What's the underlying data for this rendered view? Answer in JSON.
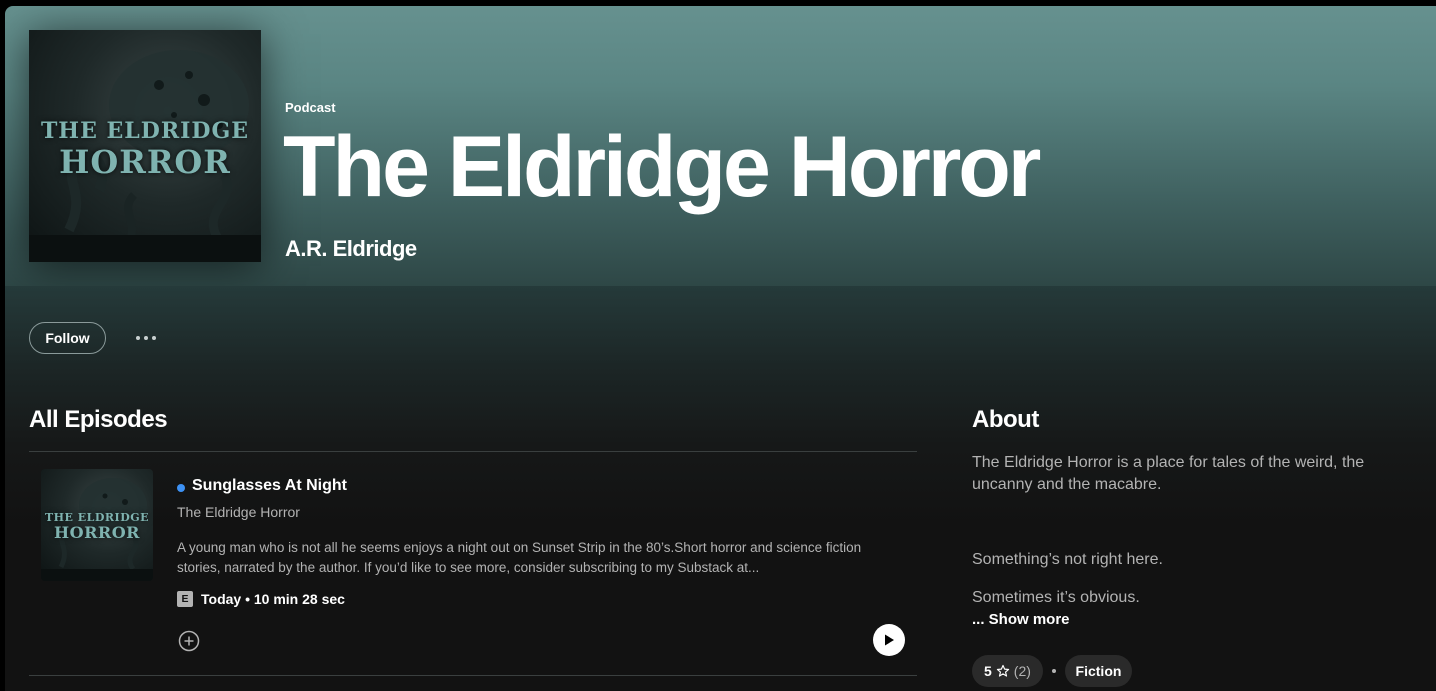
{
  "podcast": {
    "type_label": "Podcast",
    "title": "The Eldridge Horror",
    "author": "A.R. Eldridge",
    "cover_text": {
      "line1": "THE ELDRIDGE",
      "line2": "HORROR"
    }
  },
  "actions": {
    "follow_label": "Follow",
    "more_icon": "more-options-icon"
  },
  "episodes": {
    "section_title": "All Episodes",
    "items": [
      {
        "title": "Sunglasses At Night",
        "show": "The Eldridge Horror",
        "description": "A young man who is not all he seems enjoys a night out on Sunset Strip in the 80’s.Short horror and science fiction stories, narrated by the author. If you’d like to see more, consider subscribing to my Substack at...",
        "explicit_badge": "E",
        "meta": "Today • 10 min 28 sec",
        "new_indicator_color": "#3d91f4",
        "add_icon": "add-circle-icon",
        "play_icon": "play-icon"
      }
    ]
  },
  "about": {
    "title": "About",
    "paragraphs": [
      "The Eldridge Horror is a place for tales of the weird, the uncanny and the macabre.",
      "Something’s not right here.",
      "Sometimes it’s obvious."
    ],
    "show_more": "... Show more",
    "rating_value": "5",
    "rating_count": "(2)",
    "rating_icon": "star-outline-icon",
    "genre": "Fiction"
  },
  "colors": {
    "header_teal": "#66918f",
    "background": "#121212",
    "text_secondary": "#b3b3b3",
    "accent_blue": "#3d91f4"
  }
}
